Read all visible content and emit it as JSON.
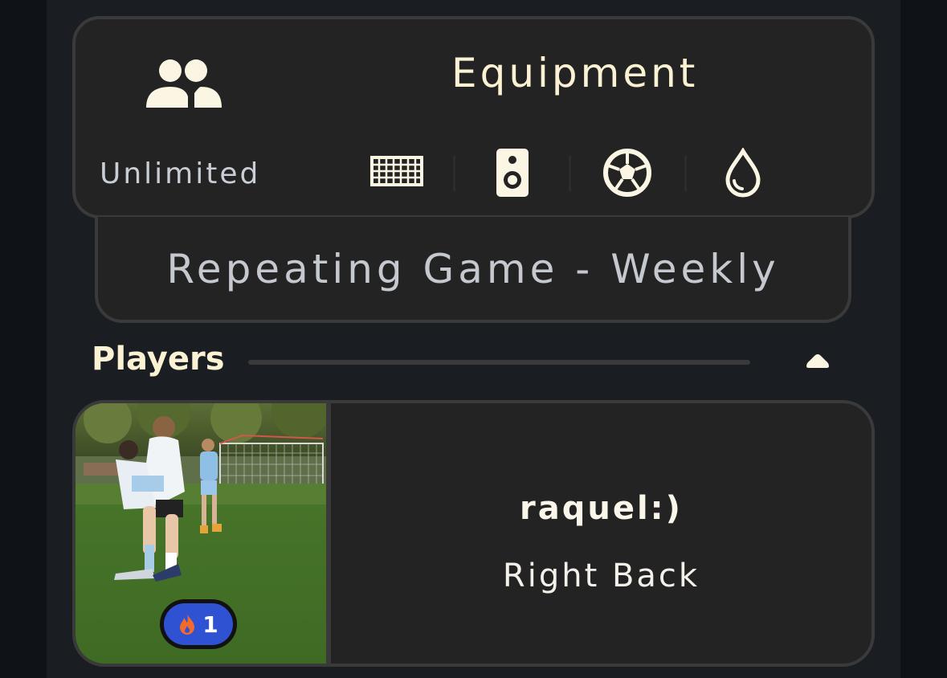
{
  "info": {
    "capacity_icon": "people-icon",
    "capacity_label": "Unlimited",
    "equipment_title": "Equipment",
    "equipment_icons": [
      "goal-net-icon",
      "speaker-icon",
      "soccer-ball-icon",
      "water-drop-icon"
    ]
  },
  "schedule": {
    "label": "Repeating Game - Weekly"
  },
  "players_section": {
    "title": "Players",
    "toggle_icon": "caret-up-icon"
  },
  "players": [
    {
      "name": "raquel:)",
      "position": "Right Back",
      "streak_icon": "flame-icon",
      "streak_count": "1"
    }
  ],
  "colors": {
    "accent_text": "#fbf2d4",
    "badge_blue": "#2f52d3",
    "flame_orange": "#f26b2d"
  }
}
